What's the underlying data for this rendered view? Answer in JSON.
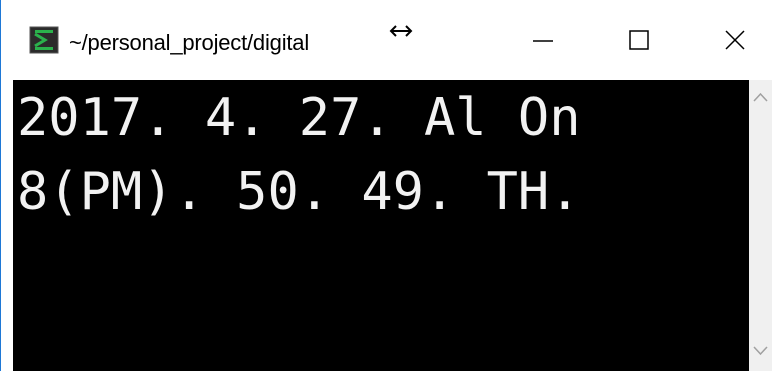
{
  "window": {
    "title": "~/personal_project/digital",
    "app_icon": "mintty-terminal-icon",
    "buttons": {
      "minimize_icon": "minimize-icon",
      "maximize_icon": "maximize-icon",
      "close_icon": "close-icon"
    }
  },
  "terminal": {
    "lines": [
      "2017. 4. 27. Al On",
      "8(PM). 50. 49. TH."
    ],
    "colors": {
      "background": "#000000",
      "text": "#f2f2f2"
    }
  },
  "colors": {
    "window_border": "#1e78d6",
    "icon_green": "#2bb24c"
  }
}
